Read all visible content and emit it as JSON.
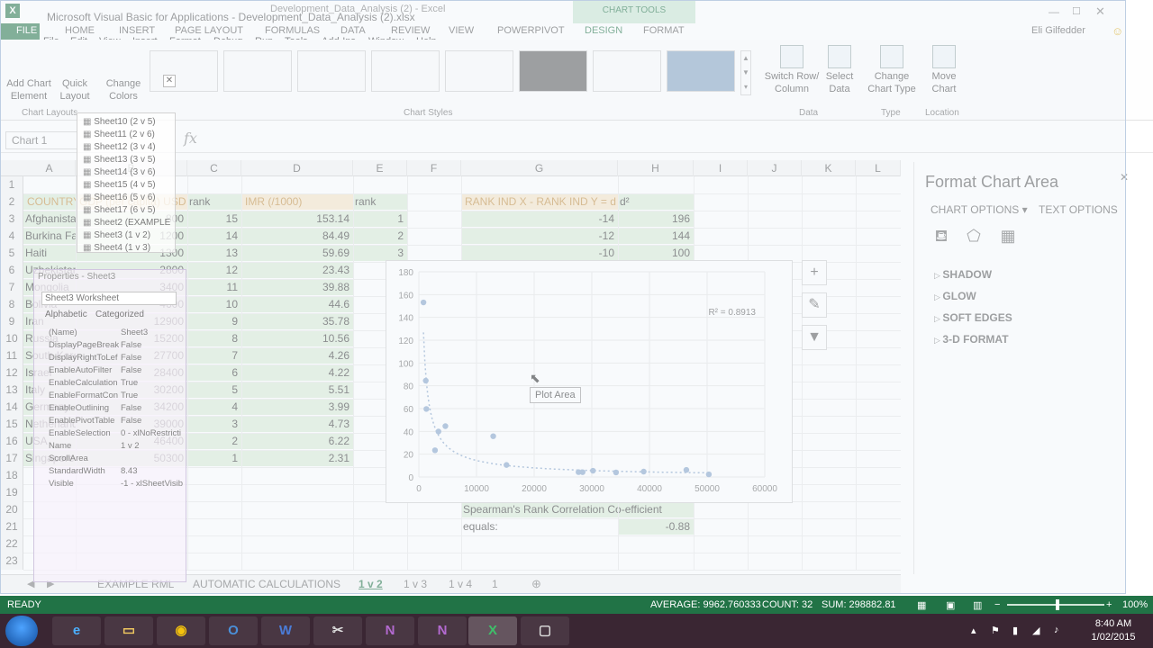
{
  "title": {
    "vba_window": "Microsoft Visual Basic for Applications - Development_Data_Analysis (2).xlsx",
    "excel_window": "Development_Data_Analysis (2) - Excel",
    "user": "Eli Gilfedder",
    "chart_tools": "CHART TOOLS"
  },
  "ribbon_tabs": [
    "FILE",
    "HOME",
    "INSERT",
    "PAGE LAYOUT",
    "FORMULAS",
    "DATA",
    "REVIEW",
    "VIEW",
    "POWERPIVOT",
    "DESIGN",
    "FORMAT"
  ],
  "vba_menu": [
    "File",
    "Edit",
    "View",
    "Insert",
    "Format",
    "Debug",
    "Run",
    "Tools",
    "Add-Ins",
    "Window",
    "Help"
  ],
  "ribbon": {
    "add_chart_element": "Add Chart Element",
    "quick_layout": "Quick Layout",
    "change_colors": "Change Colors",
    "chart_layouts_label": "Chart Layouts",
    "chart_styles_label": "Chart Styles",
    "switch_row_column": "Switch Row/ Column",
    "select_data": "Select Data",
    "data_label": "Data",
    "change_chart_type": "Change Chart Type",
    "type_label": "Type",
    "move_chart": "Move Chart",
    "location_label": "Location"
  },
  "formula_bar": {
    "name_box": "Chart 1",
    "fx": "fx"
  },
  "columns": [
    "A",
    "B",
    "C",
    "D",
    "E",
    "F",
    "G",
    "H",
    "I",
    "J",
    "K",
    "L"
  ],
  "rows": [
    "1",
    "2",
    "3",
    "4",
    "5",
    "6",
    "7",
    "8",
    "9",
    "10",
    "11",
    "12",
    "13",
    "14",
    "15",
    "16",
    "17",
    "18",
    "19",
    "20",
    "21",
    "22",
    "23"
  ],
  "sheet": {
    "headers": {
      "a": "COUNTRY",
      "b": "GDP (per capita) USD",
      "c": "rank",
      "d": "IMR (/1000)",
      "e": "rank",
      "g": "RANK IND X - RANK IND Y = d",
      "h": "d²"
    },
    "countries": [
      "Afghanistan",
      "Burkina Faso",
      "Haiti",
      "Uzbekistan",
      "Mongolia",
      "Bolivia",
      "Iran",
      "Russia",
      "South Korea",
      "Israel",
      "Italy",
      "Germany",
      "Netherlands",
      "USA",
      "Singapore"
    ],
    "gdp": [
      "800",
      "1200",
      "1300",
      "2800",
      "3400",
      "4600",
      "12900",
      "15200",
      "27700",
      "28400",
      "30200",
      "34200",
      "39000",
      "46400",
      "50300"
    ],
    "gdp_rank": [
      "15",
      "14",
      "13",
      "12",
      "11",
      "10",
      "9",
      "8",
      "7",
      "6",
      "5",
      "4",
      "3",
      "2",
      "1"
    ],
    "imr": [
      "153.14",
      "84.49",
      "59.69",
      "23.43",
      "39.88",
      "44.6",
      "35.78",
      "10.56",
      "4.26",
      "4.22",
      "5.51",
      "3.99",
      "4.73",
      "6.22",
      "2.31"
    ],
    "imr_rank": [
      "1",
      "2",
      "3"
    ],
    "d": [
      "-14",
      "-12",
      "-10"
    ],
    "d2": [
      "196",
      "144",
      "100"
    ],
    "spearman_label": "Spearman's Rank Correlation Co-efficient",
    "equals_label": "equals:",
    "equals_value": "-0.88"
  },
  "chart_data": {
    "type": "scatter",
    "title": "",
    "xlabel": "",
    "ylabel": "",
    "xlim": [
      0,
      60000
    ],
    "ylim": [
      0,
      180
    ],
    "x_ticks": [
      "0",
      "10000",
      "20000",
      "30000",
      "40000",
      "50000",
      "60000"
    ],
    "y_ticks": [
      "0",
      "20",
      "40",
      "60",
      "80",
      "100",
      "120",
      "140",
      "160",
      "180"
    ],
    "points": [
      [
        800,
        153.14
      ],
      [
        1200,
        84.49
      ],
      [
        1300,
        59.69
      ],
      [
        2800,
        23.43
      ],
      [
        3400,
        39.88
      ],
      [
        4600,
        44.6
      ],
      [
        12900,
        35.78
      ],
      [
        15200,
        10.56
      ],
      [
        27700,
        4.26
      ],
      [
        28400,
        4.22
      ],
      [
        30200,
        5.51
      ],
      [
        34200,
        3.99
      ],
      [
        39000,
        4.73
      ],
      [
        46400,
        6.22
      ],
      [
        50300,
        2.31
      ]
    ],
    "r2_label": "R² = 0.8913",
    "trendline": "power",
    "point_color": "#7f9fc6",
    "grid": true,
    "legend": "none"
  },
  "chart_tooltip": "Plot Area",
  "chart_buttons": {
    "elements": "+",
    "styles": "✎",
    "filters": "▼"
  },
  "vba_project": {
    "items": [
      "Sheet10 (2 v 5)",
      "Sheet11 (2 v 6)",
      "Sheet12 (3 v 4)",
      "Sheet13 (3 v 5)",
      "Sheet14 (3 v 6)",
      "Sheet15 (4 v 5)",
      "Sheet16 (5 v 6)",
      "Sheet17 (6 v 5)",
      "Sheet2 (EXAMPLE",
      "Sheet3 (1 v 2)",
      "Sheet4 (1 v 3)"
    ],
    "props_title": "Properties - Sheet3",
    "props_object": "Sheet3 Worksheet",
    "props_tabs": [
      "Alphabetic",
      "Categorized"
    ],
    "props": [
      {
        "k": "(Name)",
        "v": "Sheet3"
      },
      {
        "k": "DisplayPageBreak",
        "v": "False"
      },
      {
        "k": "DisplayRightToLef",
        "v": "False"
      },
      {
        "k": "EnableAutoFilter",
        "v": "False"
      },
      {
        "k": "EnableCalculation",
        "v": "True"
      },
      {
        "k": "EnableFormatCon",
        "v": "True"
      },
      {
        "k": "EnableOutlining",
        "v": "False"
      },
      {
        "k": "EnablePivotTable",
        "v": "False"
      },
      {
        "k": "EnableSelection",
        "v": "0 - xlNoRestricti"
      },
      {
        "k": "Name",
        "v": "1 v 2"
      },
      {
        "k": "ScrollArea",
        "v": ""
      },
      {
        "k": "StandardWidth",
        "v": "8.43"
      },
      {
        "k": "Visible",
        "v": "-1 - xlSheetVisib"
      }
    ]
  },
  "side_panel": {
    "title": "Format Chart Area",
    "chart_options": "CHART OPTIONS",
    "text_options": "TEXT OPTIONS",
    "sections": [
      "SHADOW",
      "GLOW",
      "SOFT EDGES",
      "3-D FORMAT"
    ]
  },
  "sheet_tabs": [
    "EXAMPLE RML",
    "AUTOMATIC CALCULATIONS",
    "1 v 2",
    "1 v 3",
    "1 v 4",
    "1"
  ],
  "status": {
    "ready": "READY",
    "average": "AVERAGE: 9962.760333",
    "count": "COUNT: 32",
    "sum": "SUM: 298882.81",
    "zoom": "100%"
  },
  "taskbar": {
    "time": "8:40 AM",
    "date": "1/02/2015",
    "apps": [
      "e",
      "◉",
      "▭",
      "O",
      "W",
      "✂",
      "N",
      "N",
      "X",
      "▢"
    ]
  },
  "colors": {
    "excel_green": "#217346",
    "header_fill": "#f6e3c4",
    "cell_fill": "#d8ead4",
    "taskbar": "#3a2633"
  }
}
